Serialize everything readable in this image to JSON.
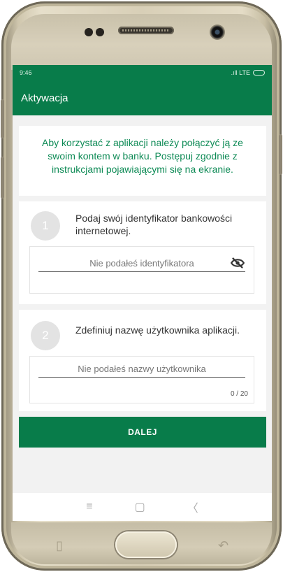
{
  "status_bar": {
    "time": "9:46",
    "network": ".ıll LTE"
  },
  "app_bar": {
    "title": "Aktywacja"
  },
  "info": {
    "text": "Aby korzystać z aplikacji należy połączyć ją ze swoim kontem w banku. Postępuj zgodnie z instrukcjami pojawiającymi się na ekranie."
  },
  "steps": [
    {
      "number": "1",
      "instruction": "Podaj swój identyfikator bankowości internetowej.",
      "placeholder": "Nie podałeś identyfikatora",
      "trailing_icon": "eye-off-icon"
    },
    {
      "number": "2",
      "instruction": "Zdefiniuj nazwę użytkownika aplikacji.",
      "placeholder": "Nie podałeś nazwy użytkownika",
      "counter": "0 / 20"
    }
  ],
  "actions": {
    "next_label": "DALEJ"
  },
  "nav_bar": {
    "icons": [
      "menu-icon",
      "home-icon",
      "back-icon"
    ]
  },
  "colors": {
    "brand_green": "#087c4a",
    "info_text_green": "#0d8a55",
    "background": "#f2f2f2",
    "step_circle": "#e3e3e3"
  }
}
